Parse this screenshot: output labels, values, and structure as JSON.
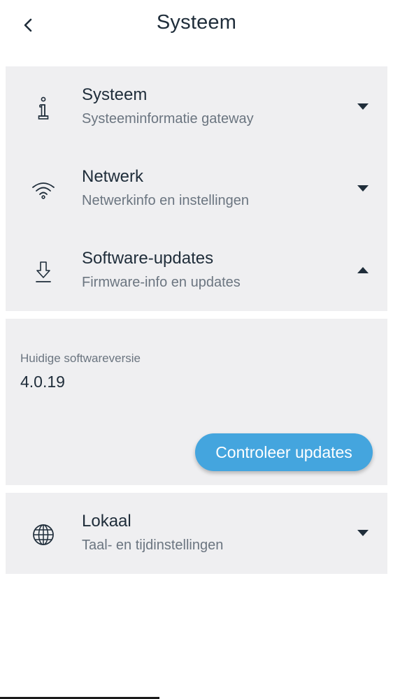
{
  "header": {
    "title": "Systeem",
    "back_icon": "chevron-left-icon"
  },
  "sections": [
    {
      "title": "Systeem",
      "subtitle": "Systeeminformatie gateway",
      "icon": "info-icon",
      "expanded": false
    },
    {
      "title": "Netwerk",
      "subtitle": "Netwerkinfo en instellingen",
      "icon": "wifi-icon",
      "expanded": false
    },
    {
      "title": "Software-updates",
      "subtitle": "Firmware-info en updates",
      "icon": "download-icon",
      "expanded": true
    },
    {
      "title": "Lokaal",
      "subtitle": "Taal- en tijdinstellingen",
      "icon": "globe-icon",
      "expanded": false
    }
  ],
  "software_detail": {
    "label": "Huidige softwareversie",
    "version": "4.0.19",
    "button_label": "Controleer updates"
  },
  "colors": {
    "accent": "#44a5de",
    "card_background": "#efeff1",
    "text_primary": "#1f2d3a",
    "text_secondary": "#6b7580"
  }
}
